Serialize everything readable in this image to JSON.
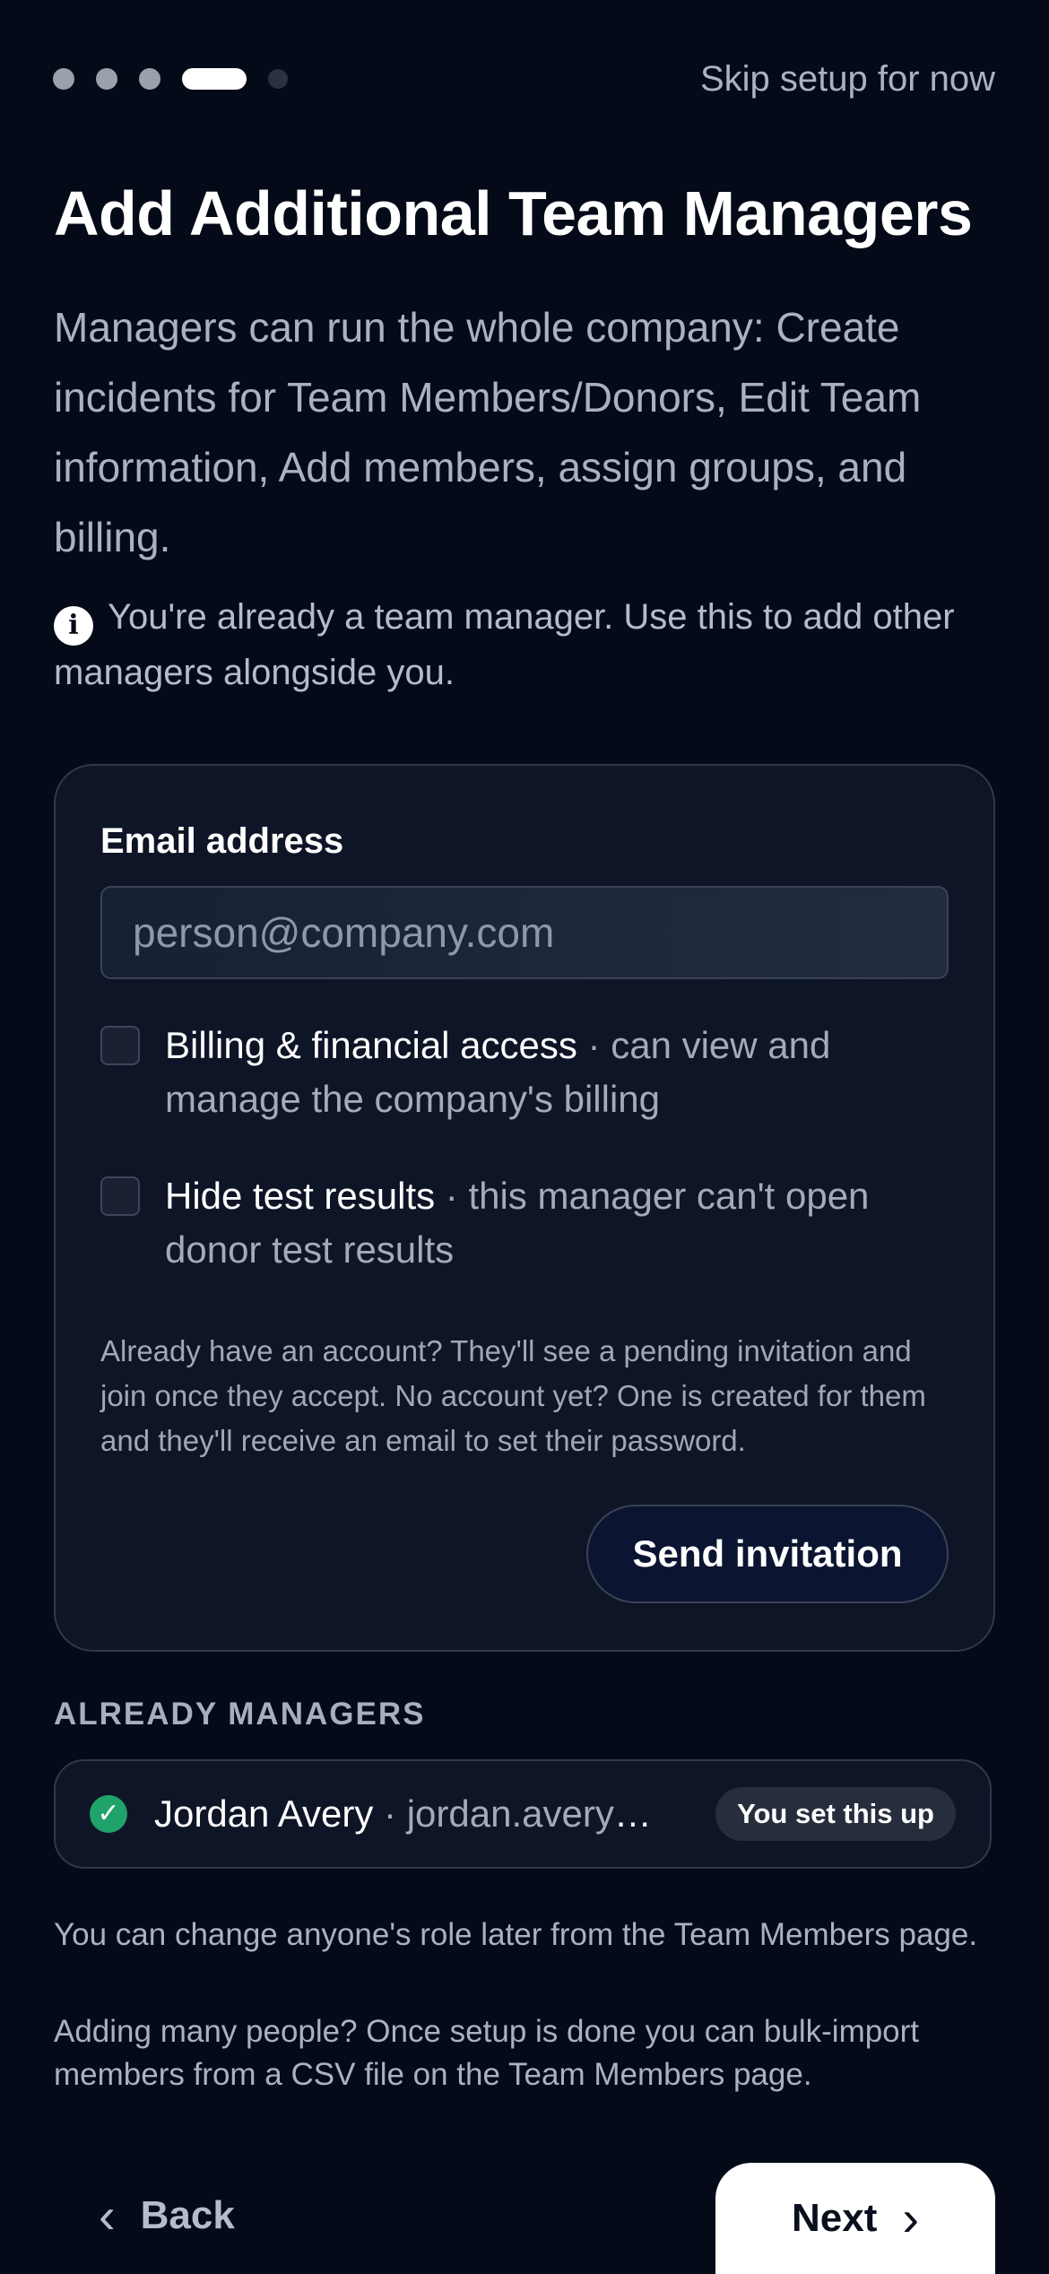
{
  "onboarding": {
    "steps_total": 5,
    "current_step": 4,
    "skip_label": "Skip setup for now"
  },
  "header": {
    "title": "Add Additional Team Managers",
    "description": "Managers can run the whole company: Create incidents for Team Members/Donors, Edit Team information, Add members, assign groups, and billing.",
    "info_icon": "info-icon",
    "info_text": "You're already a team manager. Use this to add other managers alongside you."
  },
  "invite_form": {
    "email_label": "Email address",
    "email_placeholder": "person@company.com",
    "email_value": "",
    "billing_title": "Billing & financial access",
    "billing_desc": " · can view and manage the company's billing",
    "billing_checked": false,
    "hide_title": "Hide test results",
    "hide_desc": " · this manager can't open donor test results",
    "hide_checked": false,
    "note": "Already have an account? They'll see a pending invitation and join once they accept. No account yet? One is created for them and they'll receive an email to set their password.",
    "send_label": "Send invitation"
  },
  "managers": {
    "section_label": "ALREADY MANAGERS",
    "items": [
      {
        "name": "Jordan Avery",
        "email": " · jordan.avery@...",
        "badge": "You set this up",
        "status_icon": "check-circle-icon",
        "status_color": "#1fa36b"
      }
    ]
  },
  "footer": {
    "role_note": "You can change anyone's role later from the Team Members page.",
    "bulk_note": "Adding many people? Once setup is done you can bulk-import members from a CSV file on the Team Members page.",
    "back_label": "Back",
    "next_label": "Next"
  },
  "colors": {
    "background": "#050a18",
    "card": "#0e1526",
    "success": "#1fa36b"
  }
}
